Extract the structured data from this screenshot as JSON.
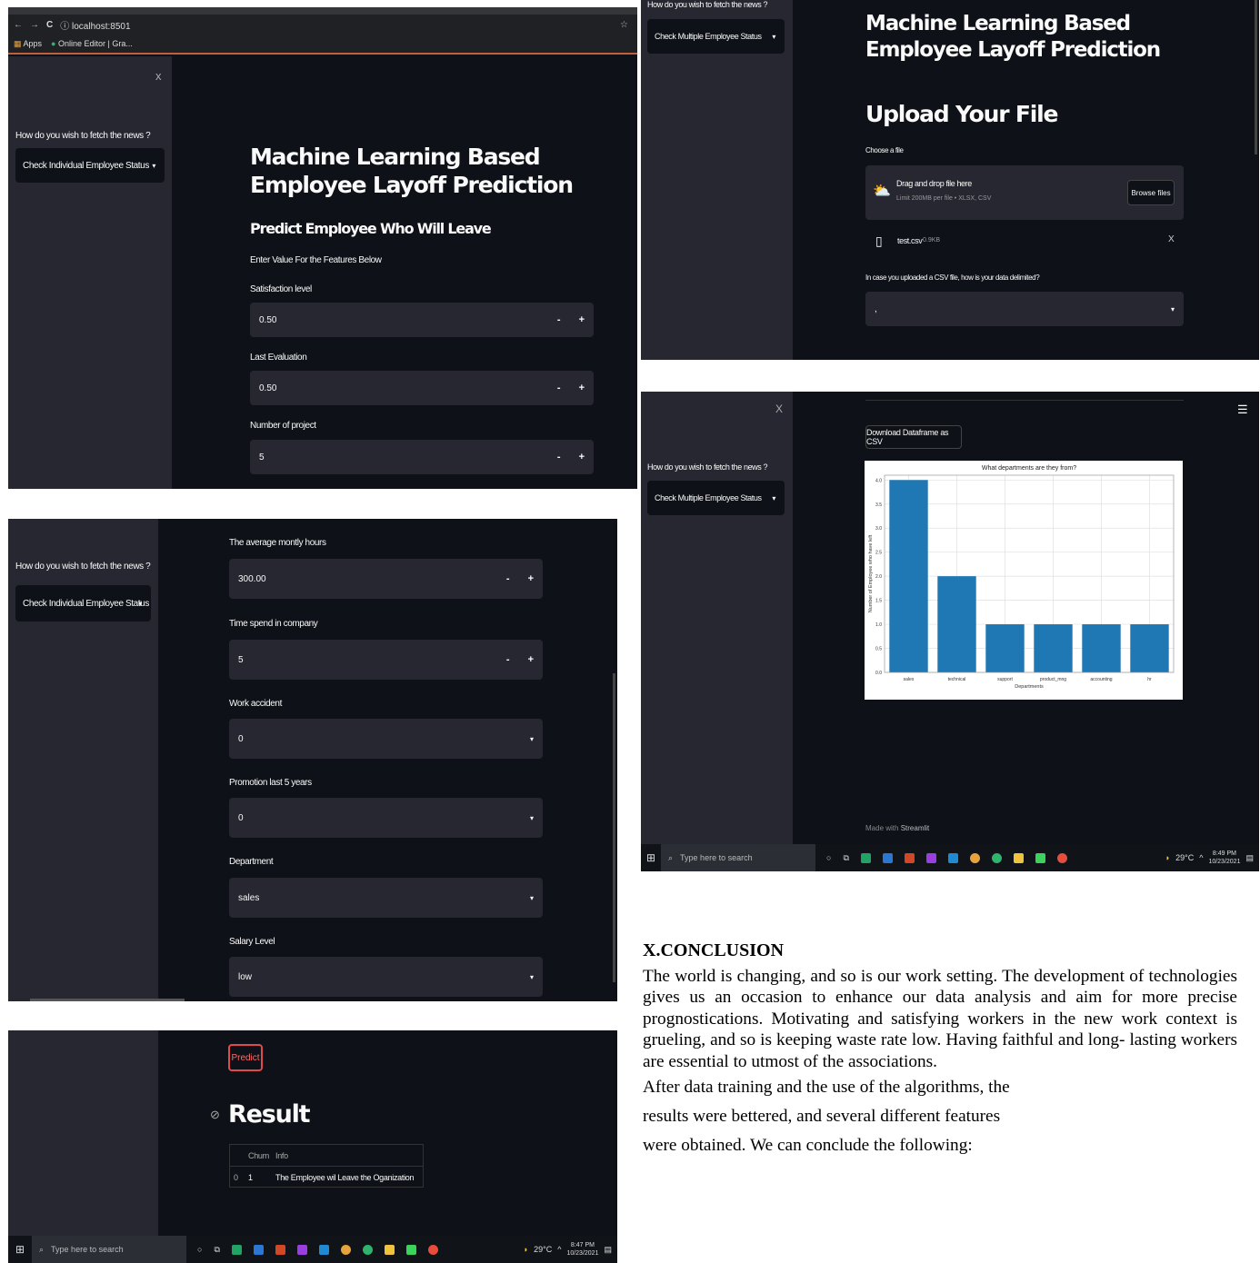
{
  "panel1": {
    "url": "localhost:8501",
    "bookmarks": [
      "Apps",
      "Online Editor | Gra..."
    ],
    "close": "x",
    "sidebar_label": "How do you wish to fetch the news ?",
    "sidebar_select": "Check Individual Employee Status",
    "title": "Machine Learning Based Employee Layoff Prediction",
    "subtitle": "Predict Employee Who Will Leave",
    "instruction": "Enter Value For the Features Below",
    "fields": [
      {
        "label": "Satisfaction level",
        "value": "0.50"
      },
      {
        "label": "Last Evaluation",
        "value": "0.50"
      },
      {
        "label": "Number of project",
        "value": "5"
      }
    ]
  },
  "panel2": {
    "sidebar_label": "How do you wish to fetch the news ?",
    "sidebar_select": "Check Individual Employee Status",
    "numeric_fields": [
      {
        "label": "The average montly hours",
        "value": "300.00"
      },
      {
        "label": "Time spend in company",
        "value": "5"
      }
    ],
    "select_fields": [
      {
        "label": "Work accident",
        "value": "0"
      },
      {
        "label": "Promotion last 5 years",
        "value": "0"
      },
      {
        "label": "Department",
        "value": "sales"
      },
      {
        "label": "Salary Level",
        "value": "low"
      }
    ]
  },
  "panel3": {
    "predict_label": "Predict",
    "result_heading": "Result",
    "table": {
      "headers": [
        "",
        "Churn",
        "Info"
      ],
      "rows": [
        [
          "0",
          "1",
          "The Employee wil Leave the Oganization"
        ]
      ]
    },
    "taskbar": {
      "search": "Type here to search",
      "temp": "29°C",
      "time": "8:47 PM",
      "date": "10/23/2021"
    }
  },
  "panel4": {
    "sidebar_label": "How do you wish to fetch the news ?",
    "sidebar_select": "Check Multiple Employee Status",
    "title": "Machine Learning Based Employee Layoff Prediction",
    "upload_heading": "Upload Your File",
    "choose_label": "Choose a file",
    "drop_text": "Drag and drop file here",
    "limit_text": "Limit 200MB per file • XLSX, CSV",
    "browse_label": "Browse files",
    "file_name": "test.csv",
    "file_size": "0.9KB",
    "remove": "X",
    "delimiter_label": "In case you uploaded a CSV file, how is your data delimited?",
    "delimiter_value": ","
  },
  "panel5": {
    "close": "X",
    "menu": "☰",
    "sidebar_label": "How do you wish to fetch the news ?",
    "sidebar_select": "Check Multiple Employee Status",
    "download_label": "Download Dataframe as CSV",
    "footer": "Made with",
    "footer_brand": "Streamlit",
    "taskbar": {
      "search": "Type here to search",
      "temp": "29°C",
      "time": "8:49 PM",
      "date": "10/23/2021"
    }
  },
  "chart_data": {
    "type": "bar",
    "title": "What departments are they from?",
    "xlabel": "Departments",
    "ylabel": "Number of Employee who have left",
    "categories": [
      "sales",
      "technical",
      "support",
      "product_mng",
      "accounting",
      "hr"
    ],
    "values": [
      4,
      2,
      1,
      1,
      1,
      1
    ],
    "ylim": [
      0,
      4.1
    ],
    "yticks": [
      "0.0",
      "0.5",
      "1.0",
      "1.5",
      "2.0",
      "2.5",
      "3.0",
      "3.5",
      "4.0"
    ],
    "grid": true,
    "bar_color": "#1f77b4"
  },
  "conclusion": {
    "heading": "X.CONCLUSION",
    "body": "The world is changing, and so is our work setting. The development of technologies gives  us an occasion to enhance our data analysis and aim for more precise prognostications. Motivating and satisfying workers in the new work context is grueling, and so is keeping waste rate low. Having faithful and long- lasting workers are essential to utmost of the associations.",
    "line2": "After data training and the use of the algorithms, the",
    "line3": "results were bettered, and several different features",
    "line4": "were obtained. We can conclude the following:"
  }
}
